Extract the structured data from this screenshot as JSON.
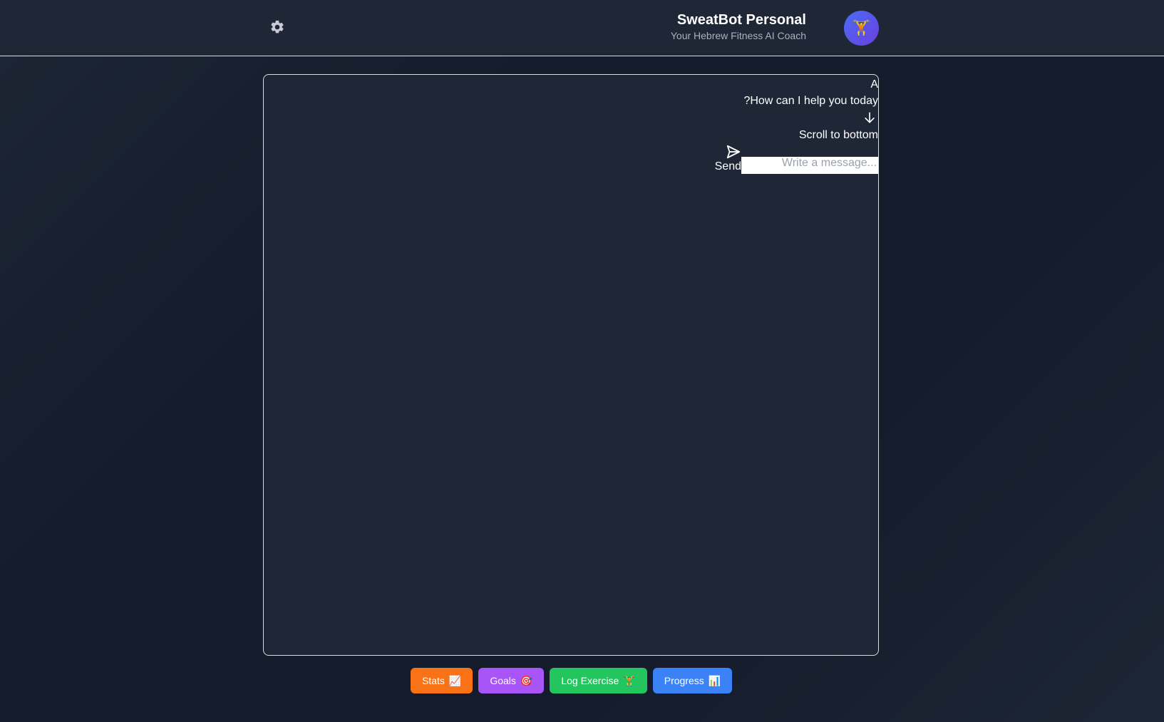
{
  "header": {
    "title": "SweatBot Personal",
    "subtitle": "Your Hebrew Fitness AI Coach",
    "settings_icon": "gear-icon",
    "avatar_emoji": "🏋️",
    "avatar_icon": "weightlifter-icon"
  },
  "chat": {
    "avatar_letter": "A",
    "greeting": "?How can I help you today",
    "scroll_label": "Scroll to bottom",
    "send_label": "Send",
    "input_placeholder": "...Write a message",
    "input_value": ""
  },
  "actions": [
    {
      "label": "Stats",
      "emoji": "📈",
      "color": "#f97316"
    },
    {
      "label": "Goals",
      "emoji": "🎯",
      "color": "#a855f7"
    },
    {
      "label": "Log Exercise",
      "emoji": "🏋️",
      "color": "#22c55e"
    },
    {
      "label": "Progress",
      "emoji": "📊",
      "color": "#3b82f6"
    }
  ],
  "colors": {
    "background": "#141b2b",
    "panel": "#1f2736",
    "border": "#d9dde4"
  }
}
